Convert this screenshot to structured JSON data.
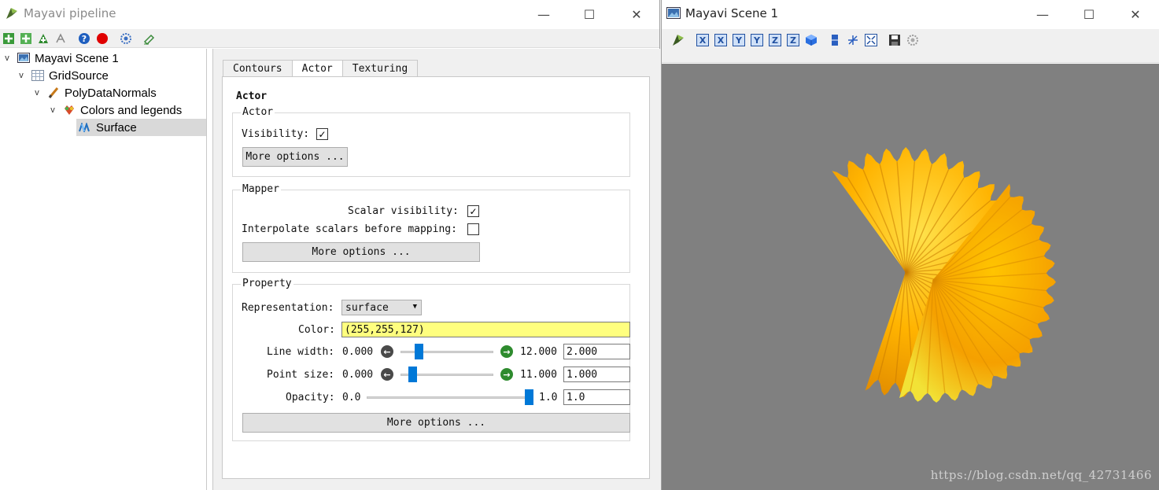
{
  "pipeline": {
    "title": "Mayavi pipeline",
    "window_controls": {
      "minimize": "—",
      "maximize": "☐",
      "close": "✕"
    },
    "tree": [
      {
        "label": "Mayavi Scene 1",
        "icon": "scene-icon",
        "depth": 0,
        "expanded": true
      },
      {
        "label": "GridSource",
        "icon": "grid-icon",
        "depth": 1,
        "expanded": true
      },
      {
        "label": "PolyDataNormals",
        "icon": "filter-icon",
        "depth": 2,
        "expanded": true
      },
      {
        "label": "Colors and legends",
        "icon": "colors-icon",
        "depth": 3,
        "expanded": true
      },
      {
        "label": "Surface",
        "icon": "surface-icon",
        "depth": 4,
        "selected": true
      }
    ],
    "tabs": [
      "Contours",
      "Actor",
      "Texturing"
    ],
    "active_tab": "Actor",
    "actor": {
      "heading": "Actor",
      "actor_group": {
        "title": "Actor",
        "visibility_label": "Visibility:",
        "visibility_checked": true,
        "more_options": "More options ..."
      },
      "mapper_group": {
        "title": "Mapper",
        "scalar_visibility_label": "Scalar visibility:",
        "scalar_visibility_checked": true,
        "interpolate_label": "Interpolate scalars before mapping:",
        "interpolate_checked": false,
        "more_options": "More options ..."
      },
      "property_group": {
        "title": "Property",
        "representation_label": "Representation:",
        "representation_value": "surface",
        "color_label": "Color:",
        "color_value": "(255,255,127)",
        "color_hex": "#ffff7f",
        "line_width": {
          "label": "Line width:",
          "min": "0.000",
          "max": "12.000",
          "value": "2.000",
          "level": 0.1667
        },
        "point_size": {
          "label": "Point size:",
          "min": "0.000",
          "max": "11.000",
          "value": "1.000",
          "level": 0.0909
        },
        "opacity": {
          "label": "Opacity:",
          "min": "0.0",
          "max": "1.0",
          "value": "1.0",
          "level": 1.0
        },
        "more_options": "More options ..."
      }
    }
  },
  "scene": {
    "title": "Mayavi Scene 1",
    "window_controls": {
      "minimize": "—",
      "maximize": "☐",
      "close": "✕"
    },
    "background_color": "#808080",
    "surface_colors": [
      "#ffd700",
      "#ffb000",
      "#f59a00"
    ],
    "watermark": "https://blog.csdn.net/qq_42731466"
  },
  "colors": {
    "accent": "#0078d7",
    "slider_arrow": "#4a4a4a",
    "right_arrow": "#2e8b2e"
  }
}
